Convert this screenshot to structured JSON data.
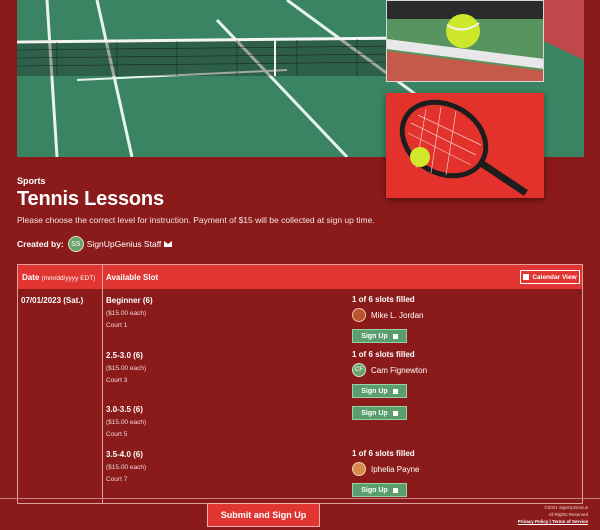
{
  "header": {
    "category": "Sports",
    "title": "Tennis Lessons",
    "description": "Please choose the correct level for instruction. Payment of $15 will be collected at sign up time.",
    "created_by_label": "Created by:",
    "creator_initials": "SS",
    "creator_name": "SignUpGenius Staff"
  },
  "table": {
    "date_header": "Date",
    "date_format": "(mm/dd/yyyy EDT)",
    "slot_header": "Available Slot",
    "calendar_button": "Calendar View",
    "date": "07/01/2023 (Sat.)",
    "slots": [
      {
        "name": "Beginner (6)",
        "price": "($15.00 each)",
        "court": "Court 1",
        "filled": "1 of 6 slots filled",
        "person": "Mike L. Jordan",
        "initials": "",
        "signup": "Sign Up"
      },
      {
        "name": "2.5-3.0 (6)",
        "price": "($15.00 each)",
        "court": "Court 3",
        "filled": "1 of 6 slots filled",
        "person": "Cam Fignewton",
        "initials": "CF",
        "signup": "Sign Up"
      },
      {
        "name": "3.0-3.5 (6)",
        "price": "($15.00 each)",
        "court": "Court 5",
        "filled": "",
        "person": "",
        "initials": "",
        "signup": "Sign Up"
      },
      {
        "name": "3.5-4.0 (6)",
        "price": "($15.00 each)",
        "court": "Court 7",
        "filled": "1 of 6 slots filled",
        "person": "Iphelia Payne",
        "initials": "",
        "signup": "Sign Up"
      }
    ]
  },
  "footer": {
    "submit": "Submit and Sign Up",
    "copyright": "©2021 SignUpGenius",
    "rights": "All Rights Reserved",
    "privacy": "Privacy Policy",
    "separator": "|",
    "terms": "Terms of Service"
  },
  "colors": {
    "background": "#8b1a1a",
    "accent": "#e03530",
    "signup": "#5a9e6e"
  }
}
